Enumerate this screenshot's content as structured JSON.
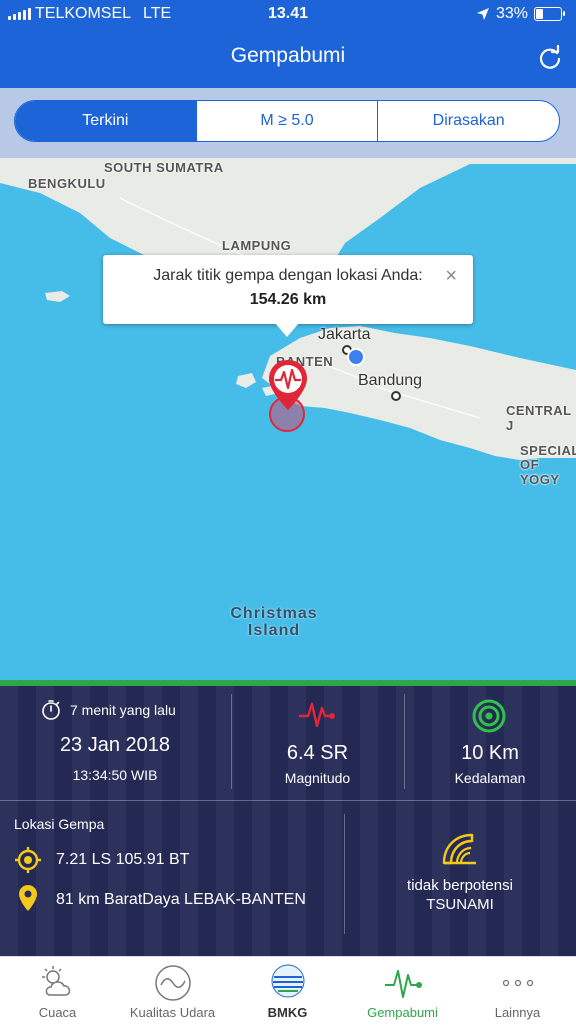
{
  "status_bar": {
    "carrier": "TELKOMSEL",
    "network": "LTE",
    "time": "13.41",
    "battery": "33%",
    "battery_level": 0.33
  },
  "header": {
    "title": "Gempabumi"
  },
  "tabs": [
    {
      "label": "Terkini",
      "active": true
    },
    {
      "label": "M ≥ 5.0",
      "active": false
    },
    {
      "label": "Dirasakan",
      "active": false
    }
  ],
  "map": {
    "labels": {
      "south_sumatra": "SOUTH SUMATRA",
      "bengkulu": "BENGKULU",
      "lampung": "LAMPUNG",
      "jakarta": "Jakarta",
      "banten": "BANTEN",
      "bandung": "Bandung",
      "central_java": "CENTRAL J",
      "special_region": "SPECIAL",
      "yogy": "OF YOGY",
      "christmas_island": "Christmas",
      "christmas_island_2": "Island"
    },
    "popup": {
      "title": "Jarak titik gempa dengan lokasi Anda:",
      "value": "154.26 km",
      "close": "×"
    }
  },
  "quake": {
    "relative_time": "7 menit yang lalu",
    "date": "23 Jan 2018",
    "time": "13:34:50 WIB",
    "magnitude": "6.4 SR",
    "magnitude_label": "Magnitudo",
    "depth": "10 Km",
    "depth_label": "Kedalaman",
    "location_header": "Lokasi Gempa",
    "coordinates": "7.21 LS 105.91 BT",
    "region": "81 km BaratDaya LEBAK-BANTEN",
    "tsunami_line1": "tidak berpotensi",
    "tsunami_line2": "TSUNAMI"
  },
  "tabbar": [
    {
      "label": "Cuaca",
      "icon": "weather-cloud-sun-icon"
    },
    {
      "label": "Kualitas Udara",
      "icon": "air-quality-icon"
    },
    {
      "label": "BMKG",
      "icon": "bmkg-logo"
    },
    {
      "label": "Gempabumi",
      "icon": "seismograph-icon",
      "active": true
    },
    {
      "label": "Lainnya",
      "icon": "more-dots-icon"
    }
  ],
  "colors": {
    "primary_blue": "#1c64d8",
    "active_green": "#2fa64a",
    "panel_navy": "#262b57",
    "accent_yellow": "#f2c81a",
    "quake_red": "#e0273a",
    "sea": "#46bde8"
  }
}
